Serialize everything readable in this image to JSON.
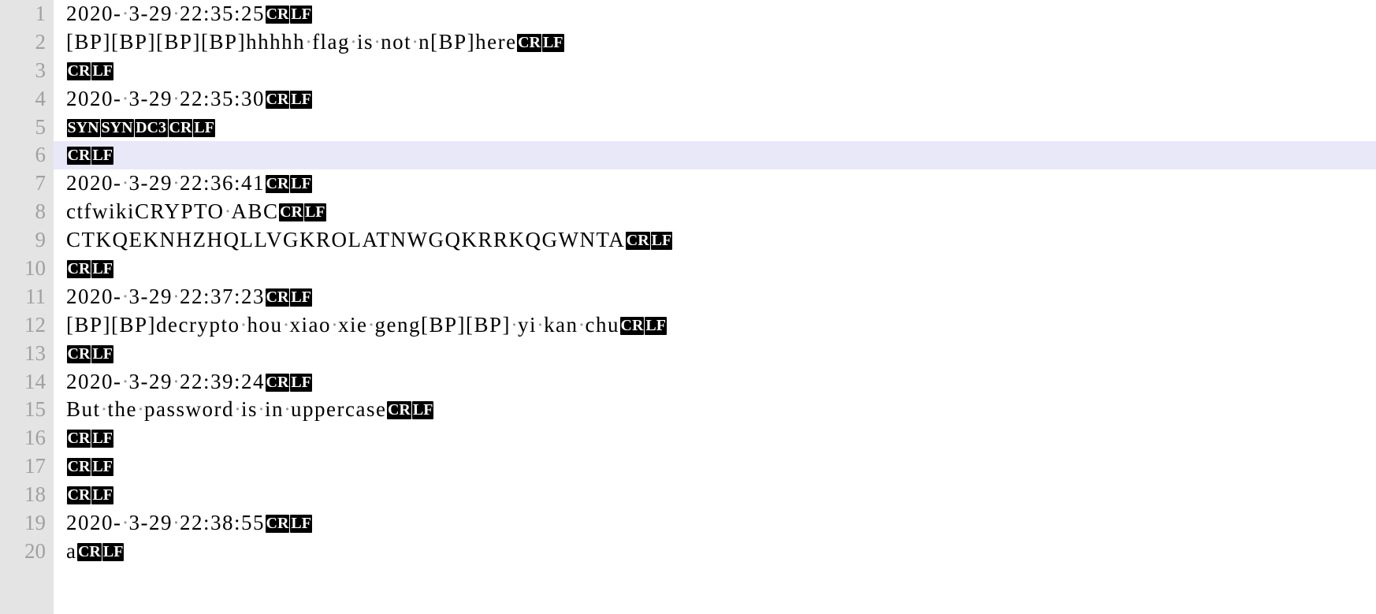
{
  "editor": {
    "name": "text-editor-view",
    "eol_cr_label": "CR",
    "eol_lf_label": "LF",
    "colors": {
      "background": "#ffffff",
      "gutter": "#e4e4e4",
      "line_number": "#a0a0a0",
      "text": "#000000",
      "current_line_highlight": "#e8e8f8",
      "control_char_bg": "#000000",
      "control_char_fg": "#ffffff",
      "space_dot": "#9a9a9a"
    },
    "current_line": 6,
    "first_visible_line": 1,
    "last_visible_line": 20
  },
  "lines": [
    {
      "number": "1",
      "text": "2020-·3-29·22:35:25",
      "plain": "2020- 3-29 22:35:25",
      "eol": "CRLF",
      "current": false
    },
    {
      "number": "2",
      "text": "[BP][BP][BP][BP]hhhhh·flag·is·not·n[BP]here",
      "plain": "[BP][BP][BP][BP]hhhhh flag is not n[BP]here",
      "eol": "CRLF",
      "current": false
    },
    {
      "number": "3",
      "text": "",
      "plain": "",
      "eol": "CRLF",
      "current": false
    },
    {
      "number": "4",
      "text": "2020-·3-29·22:35:30",
      "plain": "2020- 3-29 22:35:30",
      "eol": "CRLF",
      "current": false
    },
    {
      "number": "5",
      "text": "SYNSYNDC3",
      "plain": "SYNSYNDC3",
      "eol": "CRLF",
      "current": false,
      "control_tokens": [
        "SYN",
        "SYN",
        "DC3"
      ]
    },
    {
      "number": "6",
      "text": "",
      "plain": "",
      "eol": "CRLF",
      "current": true
    },
    {
      "number": "7",
      "text": "2020-·3-29·22:36:41",
      "plain": "2020- 3-29 22:36:41",
      "eol": "CRLF",
      "current": false
    },
    {
      "number": "8",
      "text": "ctfwikiCRYPTO·ABC",
      "plain": "ctfwikiCRYPTO ABC",
      "eol": "CRLF",
      "current": false
    },
    {
      "number": "9",
      "text": "CTKQEKNHZHQLLVGKROLATNWGQKRRKQGWNTA",
      "plain": "CTKQEKNHZHQLLVGKROLATNWGQKRRKQGWNTA",
      "eol": "CRLF",
      "current": false
    },
    {
      "number": "10",
      "text": "",
      "plain": "",
      "eol": "CRLF",
      "current": false
    },
    {
      "number": "11",
      "text": "2020-·3-29·22:37:23",
      "plain": "2020- 3-29 22:37:23",
      "eol": "CRLF",
      "current": false
    },
    {
      "number": "12",
      "text": "[BP][BP]decrypto·hou·xiao·xie·geng[BP][BP]·yi·kan·chu",
      "plain": "[BP][BP]decrypto hou xiao xie geng[BP][BP] yi kan chu",
      "eol": "CRLF",
      "current": false
    },
    {
      "number": "13",
      "text": "",
      "plain": "",
      "eol": "CRLF",
      "current": false
    },
    {
      "number": "14",
      "text": "2020-·3-29·22:39:24",
      "plain": "2020- 3-29 22:39:24",
      "eol": "CRLF",
      "current": false
    },
    {
      "number": "15",
      "text": "But·the·password·is·in·uppercase",
      "plain": "But the password is in uppercase",
      "eol": "CRLF",
      "current": false
    },
    {
      "number": "16",
      "text": "",
      "plain": "",
      "eol": "CRLF",
      "current": false
    },
    {
      "number": "17",
      "text": "",
      "plain": "",
      "eol": "CRLF",
      "current": false
    },
    {
      "number": "18",
      "text": "",
      "plain": "",
      "eol": "CRLF",
      "current": false
    },
    {
      "number": "19",
      "text": "2020-·3-29·22:38:55",
      "plain": "2020- 3-29 22:38:55",
      "eol": "CRLF",
      "current": false
    },
    {
      "number": "20",
      "text": "a",
      "plain": "a",
      "eol": "CRLF",
      "current": false
    }
  ]
}
